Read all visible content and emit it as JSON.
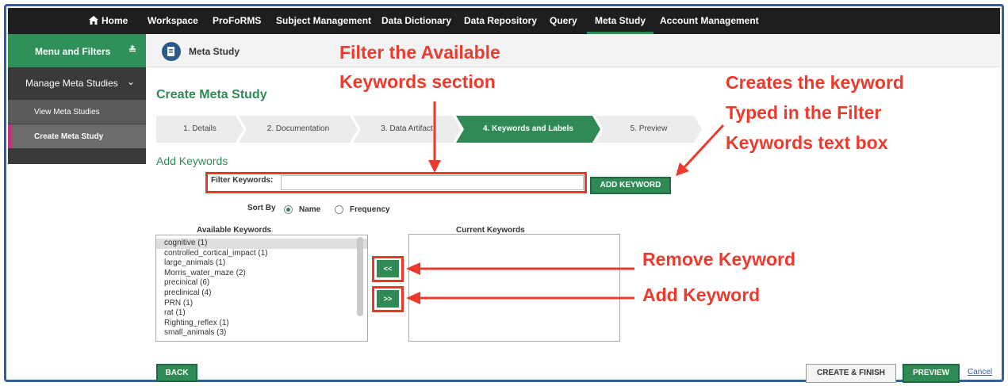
{
  "nav": {
    "home": "Home",
    "items": [
      "Workspace",
      "ProFoRMS",
      "Subject Management",
      "Data Dictionary",
      "Data Repository",
      "Query",
      "Meta Study",
      "Account Management"
    ],
    "active": "Meta Study"
  },
  "sidebar": {
    "header": "Menu and Filters",
    "section": "Manage Meta Studies",
    "items": [
      "View Meta Studies",
      "Create Meta Study"
    ],
    "active": "Create Meta Study"
  },
  "page": {
    "band_title": "Meta Study",
    "title": "Create Meta Study"
  },
  "steps": [
    "1. Details",
    "2. Documentation",
    "3. Data Artifact",
    "4. Keywords and Labels",
    "5. Preview"
  ],
  "active_step": "4. Keywords and Labels",
  "keywords": {
    "section_title": "Add Keywords",
    "filter_label": "Filter Keywords:",
    "filter_value": "",
    "add_button": "ADD KEYWORD",
    "sort_label": "Sort By",
    "sort_options": [
      "Name",
      "Frequency"
    ],
    "sort_selected": "Name",
    "available_title": "Available Keywords",
    "current_title": "Current Keywords",
    "available": [
      "cognitive (1)",
      "controlled_cortical_impact (1)",
      "large_animals (1)",
      "Morris_water_maze (2)",
      "precinical (6)",
      "preclinical (4)",
      "PRN (1)",
      "rat (1)",
      "Righting_reflex (1)",
      "small_animals (3)"
    ],
    "selected_available": "cognitive (1)",
    "current": [],
    "remove_button": "<<",
    "add_move_button": ">>"
  },
  "footer": {
    "back": "BACK",
    "create_finish": "CREATE & FINISH",
    "preview": "PREVIEW",
    "cancel": "Cancel"
  },
  "annotations": {
    "filter_line1": "Filter the Available",
    "filter_line2": "Keywords section",
    "creates_line1": "Creates the keyword",
    "creates_line2": "Typed in the Filter",
    "creates_line3": "Keywords text box",
    "remove": "Remove Keyword",
    "add": "Add Keyword"
  },
  "colors": {
    "accent_green": "#2f8a55",
    "annotation_red": "#ec3a2c",
    "nav_bg": "#1e1e1e",
    "frame_blue": "#2d5ea8"
  }
}
